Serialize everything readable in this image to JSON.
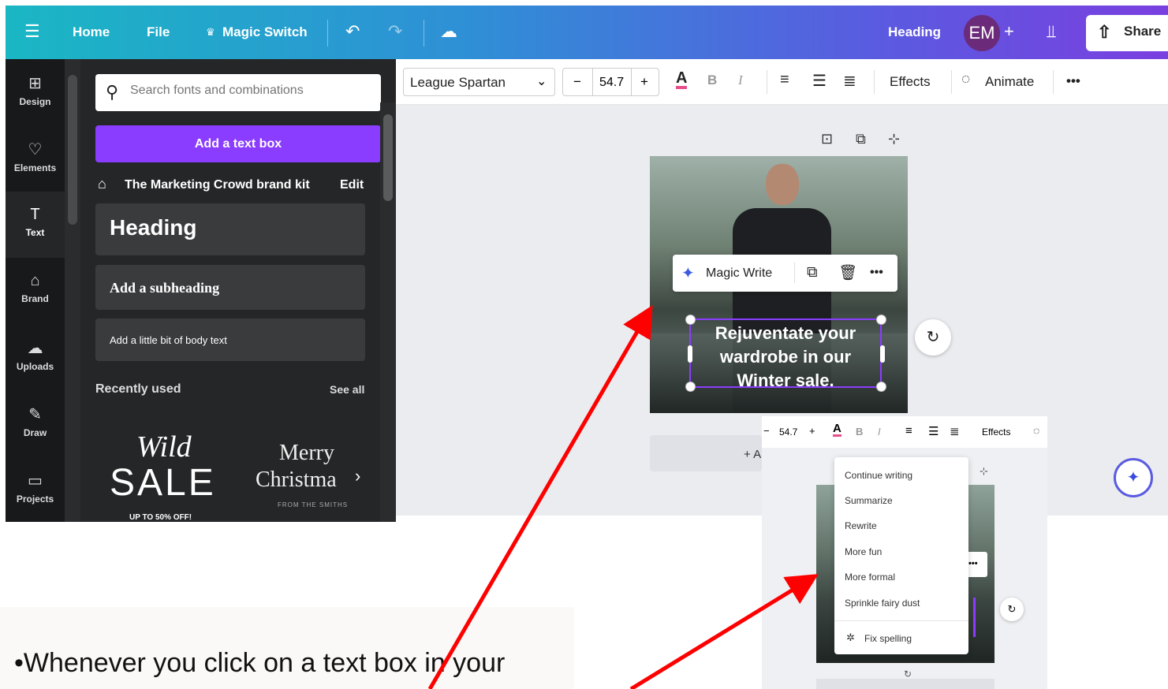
{
  "topbar": {
    "home": "Home",
    "file": "File",
    "magic_switch": "Magic Switch",
    "heading_label": "Heading",
    "avatar_initials": "EM",
    "share": "Share"
  },
  "rail": {
    "items": [
      {
        "label": "Design",
        "icon": "layout-icon"
      },
      {
        "label": "Elements",
        "icon": "shapes-icon"
      },
      {
        "label": "Text",
        "icon": "text-icon"
      },
      {
        "label": "Brand",
        "icon": "brand-icon"
      },
      {
        "label": "Uploads",
        "icon": "cloud-upload-icon"
      },
      {
        "label": "Draw",
        "icon": "pen-icon"
      },
      {
        "label": "Projects",
        "icon": "folder-icon"
      }
    ]
  },
  "panel": {
    "search_placeholder": "Search fonts and combinations",
    "add_text_box": "Add a text box",
    "brand_kit": "The Marketing Crowd brand kit",
    "brand_edit": "Edit",
    "heading": "Heading",
    "subheading": "Add a subheading",
    "body_text": "Add a little bit of body text",
    "recently_used": "Recently used",
    "see_all": "See all",
    "thumb1_line1": "Wild",
    "thumb1_line2": "SALE",
    "thumb1_line3": "UP TO 50% OFF!",
    "thumb2_line1": "Merry",
    "thumb2_line2": "Christma",
    "thumb2_line3": "FROM THE SMITHS"
  },
  "toolbar": {
    "font": "League Spartan",
    "font_size": "54.7",
    "minus": "−",
    "plus": "+",
    "effects": "Effects",
    "animate": "Animate",
    "more": "•••"
  },
  "canvas": {
    "magic_write": "Magic Write",
    "text_box": "Rejuventate your wardrobe in our Winter sale.",
    "add_page_partial": "+ A"
  },
  "inset": {
    "font_size": "54.7",
    "effects": "Effects",
    "menu": [
      "Continue writing",
      "Summarize",
      "Rewrite",
      "More fun",
      "More formal",
      "Sprinkle fairy dust"
    ],
    "fix_spelling": "Fix spelling"
  },
  "notes": {
    "line1": "•Whenever you click on a text box in your"
  },
  "colors": {
    "accent": "#8b3dff",
    "arrow": "#ff0000"
  }
}
